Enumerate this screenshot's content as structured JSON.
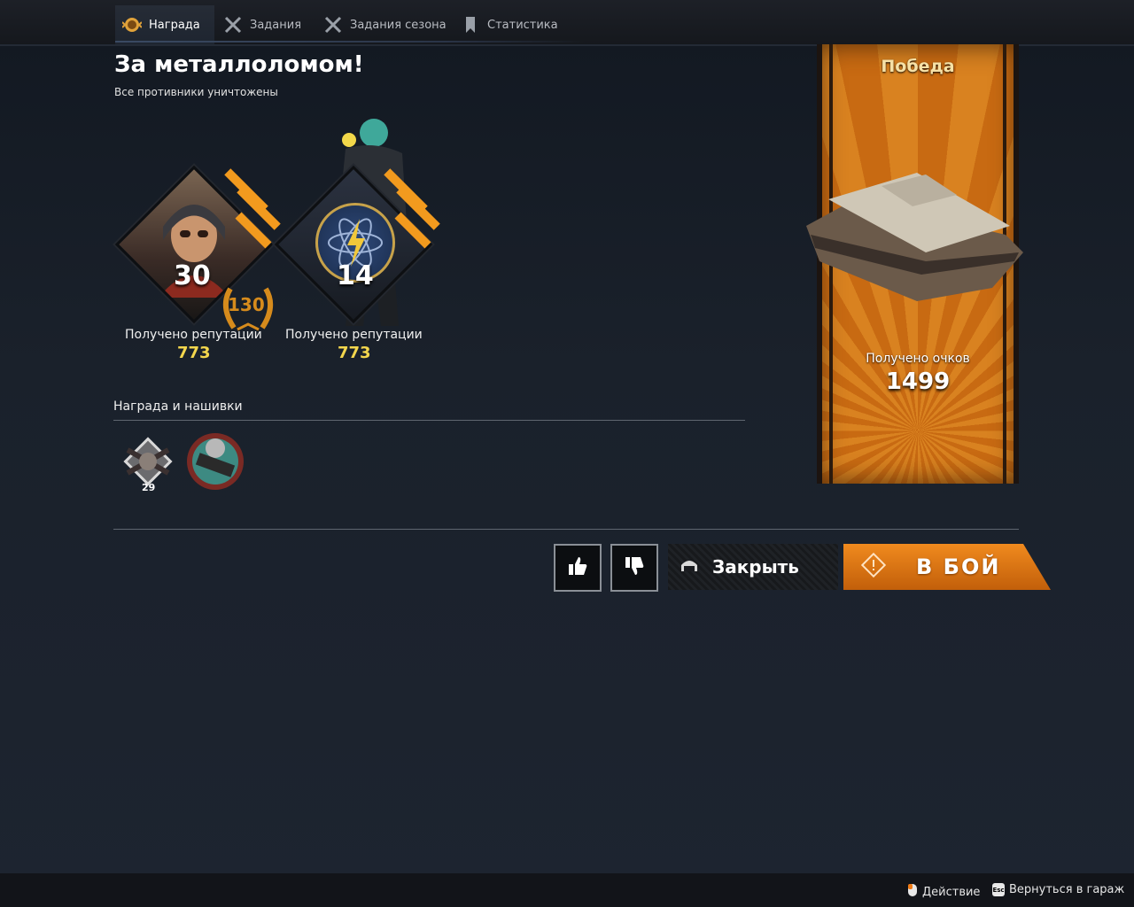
{
  "tabs": [
    {
      "label": "Награда",
      "icon": "reward-icon",
      "active": true
    },
    {
      "label": "Задания",
      "icon": "crossed-swords-icon"
    },
    {
      "label": "Задания сезона",
      "icon": "crossed-swords-icon"
    },
    {
      "label": "Статистика",
      "icon": "bookmark-icon"
    }
  ],
  "result": {
    "title": "За металлоломом!",
    "subtitle": "Все противники уничтожены"
  },
  "factions": [
    {
      "level": "30",
      "bonus_level": "130",
      "rep_label": "Получено репутации",
      "rep_value": "773"
    },
    {
      "level": "14",
      "rep_label": "Получено репутации",
      "rep_value": "773"
    }
  ],
  "awards": {
    "title": "Награда и нашивки",
    "badges": [
      {
        "icon": "crossed-guns-badge-icon",
        "count": "29"
      },
      {
        "icon": "mvp-badge-icon"
      }
    ]
  },
  "banner": {
    "title": "Победа",
    "score_label": "Получено очков",
    "score_value": "1499"
  },
  "actions": {
    "like_icon": "thumbs-up-icon",
    "dislike_icon": "thumbs-down-icon",
    "close_label": "Закрыть",
    "fight_label": "В БОЙ"
  },
  "footer": {
    "action_hint": "Действие",
    "esc_key": "Esc",
    "garage_hint": "Вернуться в гараж"
  },
  "colors": {
    "accent_orange": "#e8791a",
    "gold": "#f3d64d"
  }
}
